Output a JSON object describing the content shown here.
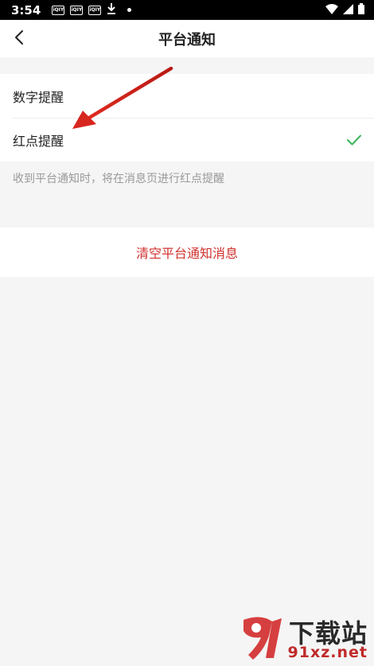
{
  "status_bar": {
    "time": "3:54",
    "app_icons": [
      "iQIY",
      "iQIY",
      "iQIY"
    ],
    "icons": [
      "download-icon",
      "wifi-icon",
      "signal-icon",
      "battery-icon"
    ]
  },
  "nav": {
    "title": "平台通知",
    "back_icon": "chevron-left-icon"
  },
  "options": [
    {
      "label": "数字提醒",
      "selected": false
    },
    {
      "label": "红点提醒",
      "selected": true
    }
  ],
  "hint": "收到平台通知时，将在消息页进行红点提醒",
  "clear_button": "清空平台通知消息",
  "colors": {
    "accent_red": "#d0312d",
    "check_green": "#3ab55c",
    "annotation_arrow": "#d7261e"
  },
  "watermark": {
    "logo_glyph": "9",
    "title": "下载站",
    "url": "91xz.net"
  }
}
